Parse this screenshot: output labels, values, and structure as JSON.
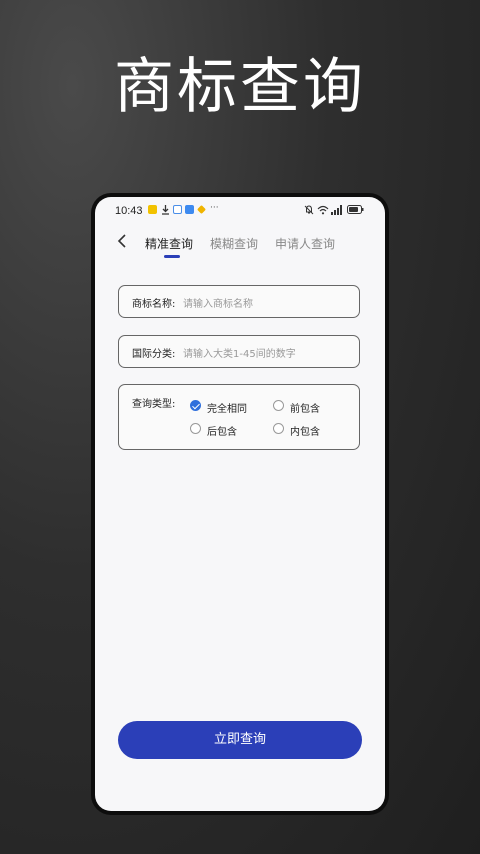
{
  "promo_title": "商标查询",
  "status": {
    "time": "10:43",
    "more": "···"
  },
  "nav": {
    "tabs": [
      {
        "label": "精准查询",
        "active": true
      },
      {
        "label": "模糊查询",
        "active": false
      },
      {
        "label": "申请人查询",
        "active": false
      }
    ]
  },
  "form": {
    "name_label": "商标名称:",
    "name_placeholder": "请输入商标名称",
    "class_label": "国际分类:",
    "class_placeholder": "请输入大类1-45间的数字",
    "type_label": "查询类型:",
    "type_options": [
      {
        "label": "完全相同",
        "selected": true
      },
      {
        "label": "前包含",
        "selected": false
      },
      {
        "label": "后包含",
        "selected": false
      },
      {
        "label": "内包含",
        "selected": false
      }
    ]
  },
  "submit_label": "立即查询",
  "colors": {
    "primary": "#2b3fb8",
    "check": "#2f6fdc"
  }
}
